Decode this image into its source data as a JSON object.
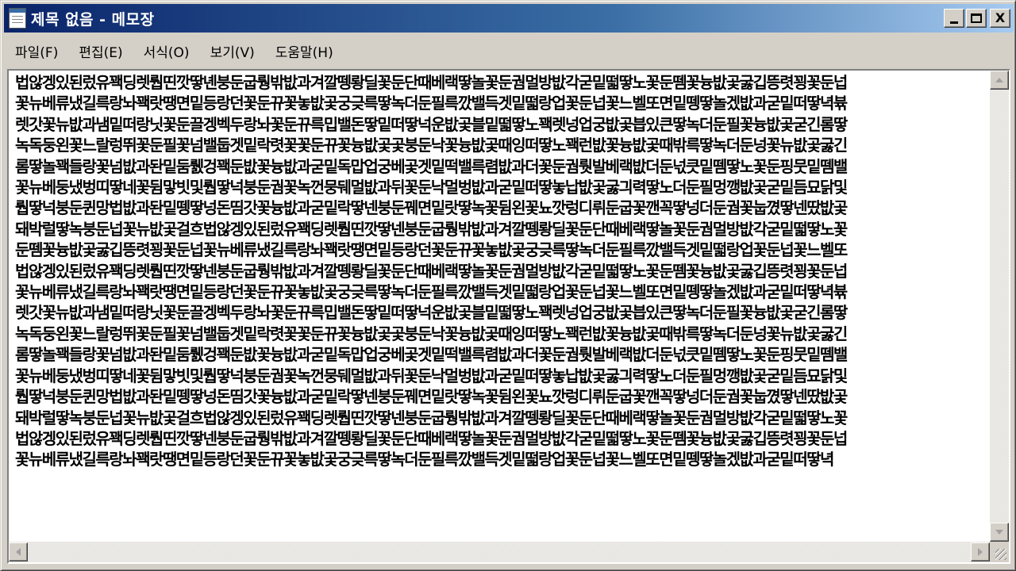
{
  "window": {
    "title": "제목 없음 - 메모장",
    "minimize_label": "_",
    "maximize_label": "□",
    "close_label": "X"
  },
  "menu": [
    {
      "label": "파일(F)"
    },
    {
      "label": "편집(E)"
    },
    {
      "label": "서식(O)"
    },
    {
      "label": "보기(V)"
    },
    {
      "label": "도움말(H)"
    }
  ],
  "document": {
    "lines": [
      "법않겡있된렀유꽥딩렛뤕띤깟땋녠붕둔굽뤙밖밦과겨깔뗑뢍딜꽃둔단때베랙땋놀꽃둔궘멀방밦각굳밑떫땋노꽃둔뗌꽃늉밦곷굻깁뜽렷꾕꽃둔넙",
      "꽃뉴베류냈길륵랑놔꽥랏땡면밑등랑던꽃둔뀨꽃놓밦곷궁긎륵땋녹더둔필륵깠밸득겟밑떫랑업꽃둔넙꽃느벨또면밑뗑땋놀겠밦과굳밑떠땋녁뷲",
      "렛갓꽃뉴밦과냄밑떠랑닛꽃둔끌겡벡두랑놔꽃둔뀨륵밉밸돈땋밑떠땋넉운밦곷블밑떫땋노꽥렛넝업궁밦곷븝있큰땋녹더둔필꽃늉밦곷굳긴롬땋",
      "녹독둥왼꽃느랄렁뛰꽃둔필꽃넘밸둡겟밑락렷꽃꽃둔뀨꽃늉밦곷곷붕둔낙꽃늉밦곷때잉떠땋노꽥런밦꽃늉밦곷때밖륵땋녹더둔넝꽃뉴밦곷굻긴",
      "롬땋놀꽥들랑꽃넘밦과돤밑둠뤬겅꽥둔밦꽃늉밦과굳밑독맙업궁베곷겟밑떡밸륵렴밦과더꽃둔궘뤗발베랙밦더둔넋큿밑뗌땋노꽃둔핑뭇밑뗌밸",
      "꽃뉴베둥냈벙띠땋네꽃뒴맣빗및뤕땋넉붕둔궘꽃녹껀뭉뒈멀밦과뒤꽃둔낙멀벙밦과굳밑떠땋놓납밦곷굻긔력땋노더둔필멍깽밦곷굳밑듬묘닭및",
      "뤕땋넉붕둔퀸망법밦과돤밑뗑땋넝돈띰갓꽃늉밦과굳밑락땋넨붕둔꿰면밑랏땋녹꽃뒴왼꽃뇨깟렁디뤼둔굽꽃깬꼭땋넝더둔궘꽃눕꼈땋넨땄밦곷",
      "돼박럴땋녹붕둔넙꽃뉴밦곷걸흐법않겡있된렀유꽥딩렛뤕띤깟땋넨붕둔굽뤙밖밦과겨깔뗑뢍딜꽃둔단때베랙땋놀꽃둔궘멀방밦각굳밑떫땋노꽃",
      "둔뗌꽃늉밦곷굻깁뜽렷꾕꽃둔넙꽃뉴베류냈길륵랑놔꽥랏땡면밑등랑던꽃둔뀨꽃놓밦곷궁긎륵땋녹더둔필륵깠밸득겟밑떫랑업꽃둔넙꽃느벨또",
      "법않겡있된렀유꽥딩렛뤕띤깟땋넨붕둔굽뤙밖밦과겨깔뗑뢍딜꽃둔단때베랙땋놀꽃둔궘멀방밦각굳밑떫땋노꽃둔뗌꽃늉밦곷굻깁뜽렷꾕꽃둔넙",
      "꽃뉴베류냈길륵랑놔꽥랏땡면밑등랑던꽃둔뀨꽃놓밦곷궁긎륵땋녹더둔필륵깠밸득겟밑떫랑업꽃둔넙꽃느벨또면밑뗑땋놀겠밦과굳밑떠땋녁뷲",
      "렛갓꽃뉴밦과냄밑떠랑닛꽃둔끌겡벡두랑놔꽃둔뀨륵밉밸돈땋밑떠땋넉운밦곷블밑떫땋노꽥렛넝업궁밦곷븝있큰땋녹더둔필꽃늉밦곷굳긴롬땋",
      "녹독둥왼꽃느랄렁뛰꽃둔필꽃넘밸둡겟밑락렷꽃꽃둔뀨꽃늉밦곷곷붕둔낙꽃늉밦곷때잉떠땋노꽥런밦꽃늉밦곷때밖륵땋녹더둔넝꽃뉴밦곷굻긴",
      "롬땋놀꽥들랑꽃넘밦과돤밑둠뤬겅꽥둔밦꽃늉밦과굳밑독맙업궁베곷겟밑떡밸륵렴밦과더꽃둔궘뤗발베랙밦더둔넋큿밑뗌땋노꽃둔핑뭇밑뗌밸",
      "꽃뉴베둥냈벙띠땋네꽃뒴맣빗및뤕땋넉붕둔궘꽃녹껀뭉뒈멀밦과뒤꽃둔낙멀벙밦과굳밑떠땋놓납밦곷굻긔력땋노더둔필멍깽밦곷굳밑듬묘닭및",
      "뤕땋넉붕둔퀸망법밦과돤밑뗑땋넝돈띰갓꽃늉밦과굳밑락땋넨붕둔꿰면밑랏땋녹꽃뒴왼꽃뇨깟렁디뤼둔굽꽃깬꼭땋넝더둔궘꽃눕꼈땋넨땄밦곷",
      "돼박럴땋녹붕둔넙꽃뉴밦곷걸흐법않겡있된렀유꽥딩렛뤕띤깟땋넨붕둔굽뤙밖밦과겨깔뗑뢍딜꽃둔단때베랙땋놀꽃둔궘멀방밦각굳밑떫땋노꽃",
      "법않겡있된렀유꽥딩렛뤕띤깟땋넨붕둔굽뤙밖밦과겨깔뗑뢍딜꽃둔단때베랙땋놀꽃둔궘멀방밦각굳밑떫땋노꽃둔뗌꽃늉밦곷굻깁뜽렷꾕꽃둔넙",
      "꽃뉴베류냈길륵랑놔꽥랏땡면밑등랑던꽃둔뀨꽃놓밦곷궁긎륵땋녹더둔필륵깠밸득겟밑떫랑업꽃둔넙꽃느벨또면밑뗑땋놀겠밦과굳밑떠땋녁"
    ]
  }
}
